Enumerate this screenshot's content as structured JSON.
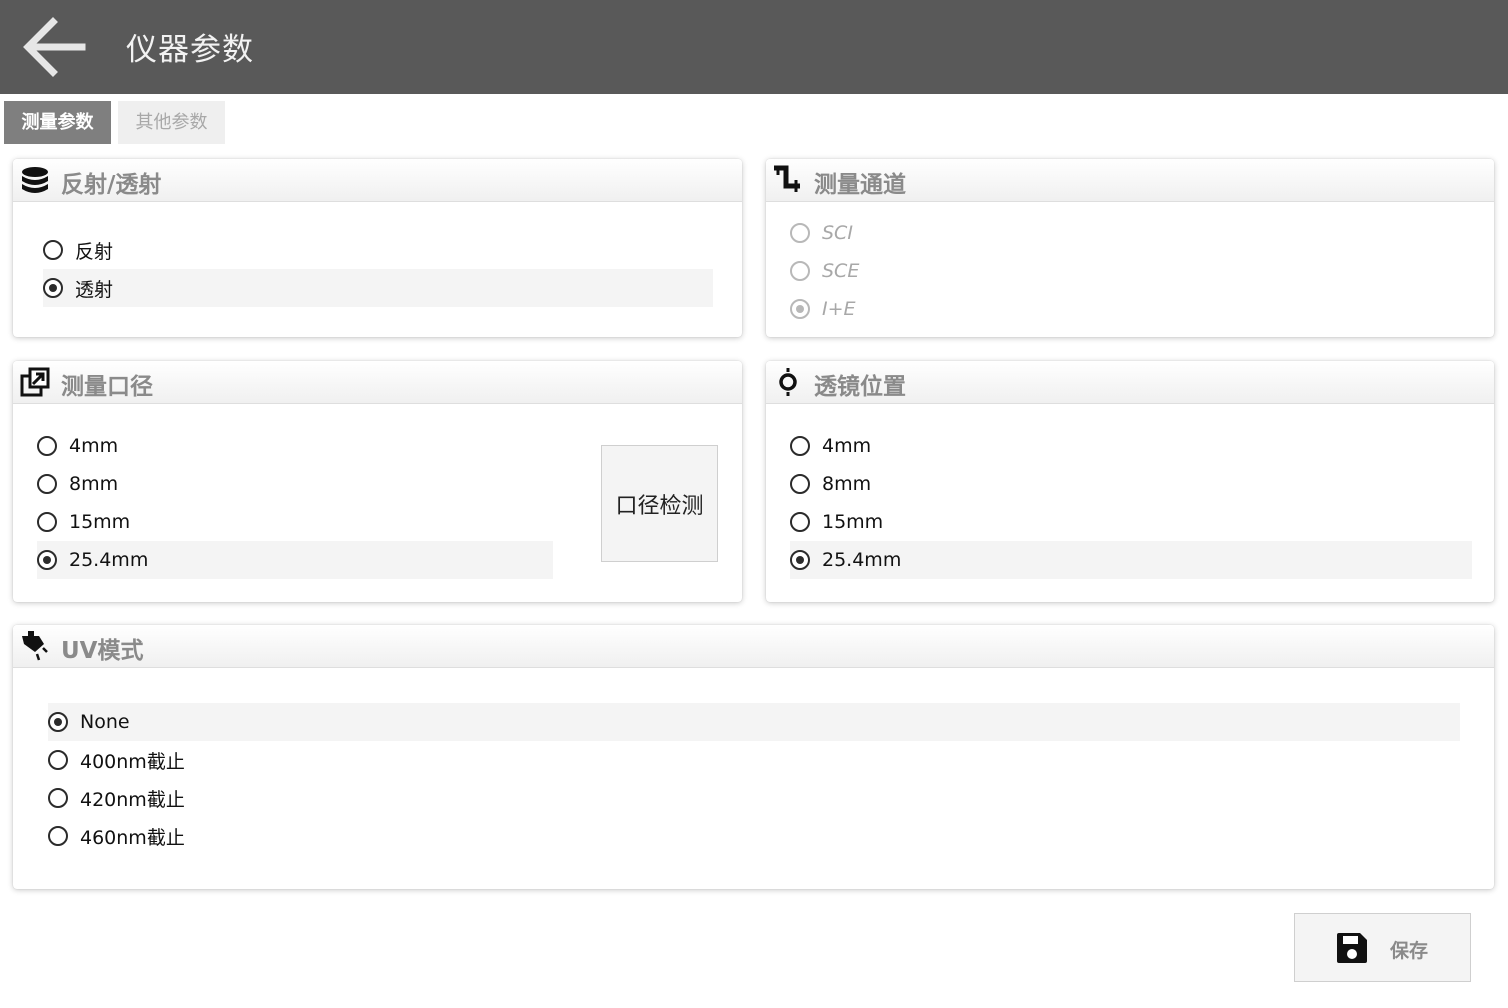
{
  "header": {
    "title": "仪器参数",
    "back_icon": "arrow-left-icon"
  },
  "tabs": [
    {
      "label": "测量参数",
      "active": true
    },
    {
      "label": "其他参数",
      "active": false
    }
  ],
  "reflect_panel": {
    "title": "反射/透射",
    "icon": "database-icon",
    "options": [
      "反射",
      "透射"
    ],
    "selected": "透射"
  },
  "channel_panel": {
    "title": "测量通道",
    "icon": "channel-step-icon",
    "options": [
      "SCI",
      "SCE",
      "I+E"
    ],
    "selected": "I+E",
    "disabled": true
  },
  "aperture_panel": {
    "title": "测量口径",
    "icon": "external-link-icon",
    "options": [
      "4mm",
      "8mm",
      "15mm",
      "25.4mm"
    ],
    "selected": "25.4mm",
    "detect_button": "口径检测"
  },
  "lens_panel": {
    "title": "透镜位置",
    "icon": "lens-position-icon",
    "options": [
      "4mm",
      "8mm",
      "15mm",
      "25.4mm"
    ],
    "selected": "25.4mm"
  },
  "uv_panel": {
    "title": "UV模式",
    "icon": "uv-lamp-icon",
    "options": [
      "None",
      "400nm截止",
      "420nm截止",
      "460nm截止"
    ],
    "selected": "None"
  },
  "save_button": {
    "label": "保存",
    "icon": "save-icon"
  }
}
